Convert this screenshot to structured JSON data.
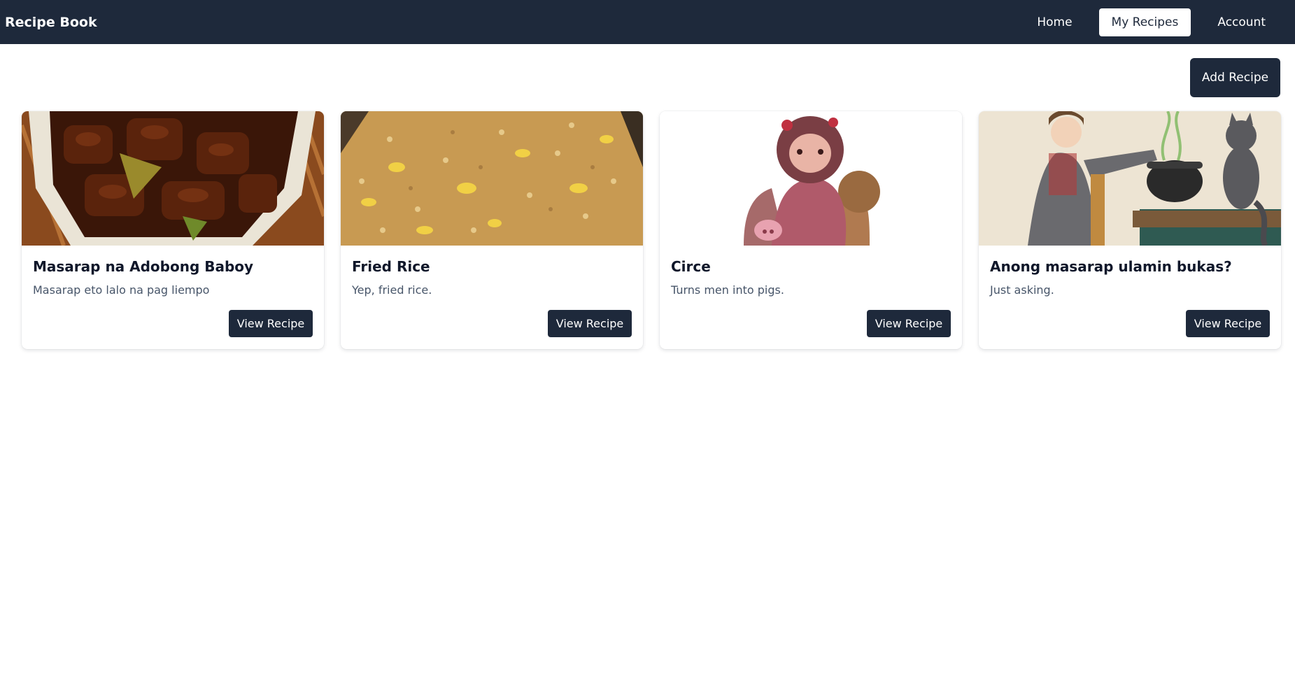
{
  "navbar": {
    "brand": "Recipe Book",
    "links": [
      {
        "label": "Home"
      },
      {
        "label": "My Recipes",
        "active": true
      },
      {
        "label": "Account"
      }
    ]
  },
  "toolbar": {
    "add_label": "Add Recipe"
  },
  "recipes": [
    {
      "title": "Masarap na Adobong Baboy",
      "description": "Masarap eto lalo na pag liempo",
      "button": "View Recipe",
      "image": "adobo-photo"
    },
    {
      "title": "Fried Rice",
      "description": "Yep, fried rice.",
      "button": "View Recipe",
      "image": "fried-rice-photo"
    },
    {
      "title": "Circe",
      "description": "Turns men into pigs.",
      "button": "View Recipe",
      "image": "circe-illustration"
    },
    {
      "title": "Anong masarap ulamin bukas?",
      "description": "Just asking.",
      "button": "View Recipe",
      "image": "witch-cauldron-cat-illustration"
    }
  ],
  "colors": {
    "navbar": "#1e293b",
    "button": "#1e293b",
    "page": "#ffffff"
  }
}
